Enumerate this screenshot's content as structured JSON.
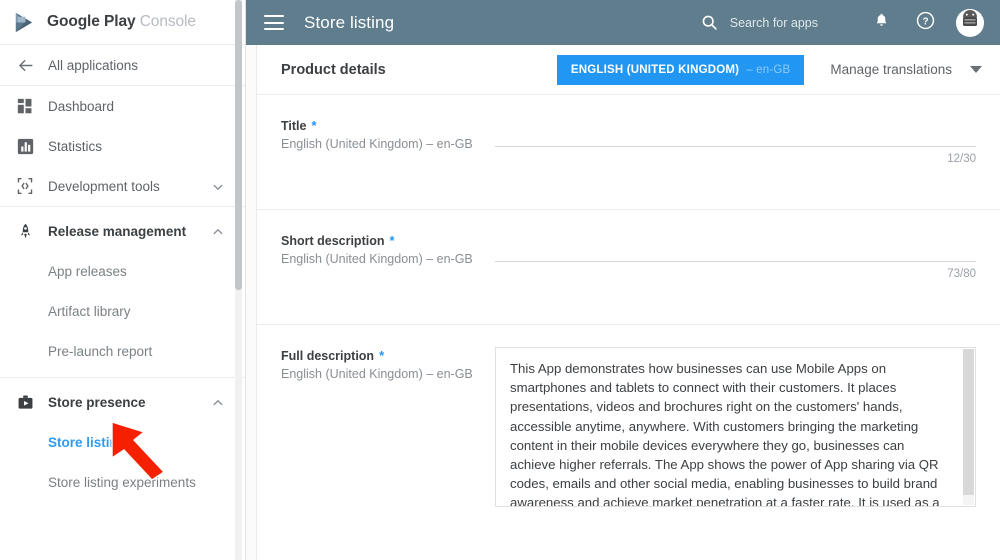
{
  "brand": {
    "primary": "Google Play",
    "secondary": "Console",
    "logo_icon": "google-play-logo"
  },
  "sidebar": {
    "back_item": {
      "label": "All applications",
      "icon": "arrow-left-icon"
    },
    "items": [
      {
        "label": "Dashboard",
        "icon": "dashboard-grid-icon",
        "expandable": false
      },
      {
        "label": "Statistics",
        "icon": "bar-chart-icon",
        "expandable": false
      },
      {
        "label": "Development tools",
        "icon": "code-brackets-icon",
        "expandable": true,
        "state": "collapsed"
      }
    ],
    "groups": [
      {
        "label": "Release management",
        "icon": "rocket-icon",
        "state": "expanded",
        "children": [
          {
            "label": "App releases",
            "active": false
          },
          {
            "label": "Artifact library",
            "active": false
          },
          {
            "label": "Pre-launch report",
            "active": false
          }
        ]
      },
      {
        "label": "Store presence",
        "icon": "store-briefcase-icon",
        "state": "expanded",
        "children": [
          {
            "label": "Store listing",
            "active": true
          },
          {
            "label": "Store listing experiments",
            "active": false
          }
        ]
      }
    ],
    "active_color": "#2f9bf3"
  },
  "topbar": {
    "menu_icon": "hamburger-menu-icon",
    "title": "Store listing",
    "search": {
      "icon": "search-icon",
      "placeholder": "Search for apps",
      "value": ""
    },
    "notifications_icon": "bell-icon",
    "help_icon": "help-circle-icon",
    "avatar_icon": "android-avatar-icon",
    "background_color": "#5f7d8c"
  },
  "panel": {
    "title": "Product details",
    "language_tab": {
      "label": "ENGLISH (UNITED KINGDOM)",
      "code": "– en-GB",
      "color": "#2196f3",
      "selected": true
    },
    "manage_translations": {
      "label": "Manage translations",
      "icon": "caret-down-icon"
    }
  },
  "fields": [
    {
      "name": "Title",
      "required_marker": "*",
      "language": "English (United Kingdom) – en-GB",
      "value": "",
      "counter": "12/30",
      "type": "text"
    },
    {
      "name": "Short description",
      "required_marker": "*",
      "language": "English (United Kingdom) – en-GB",
      "value": "",
      "counter": "73/80",
      "type": "text"
    },
    {
      "name": "Full description",
      "required_marker": "*",
      "language": "English (United Kingdom) – en-GB",
      "value": "This App demonstrates how businesses can use Mobile Apps on smartphones and tablets to connect with their customers. It places presentations, videos and brochures right on the customers' hands, accessible anytime, anywhere. With customers bringing the marketing content in their mobile devices everywhere they go, businesses can achieve higher referrals. The App shows the power of App sharing via QR codes, emails and other social media, enabling businesses to build brand awareness and achieve market penetration at a faster rate. It is used as a tool to demonstrate to businesses how customers can be drawn back to retail stores by",
      "counter": "",
      "type": "textarea"
    }
  ],
  "annotation": {
    "arrow_color": "#f52000",
    "points_at": "Store listing"
  }
}
